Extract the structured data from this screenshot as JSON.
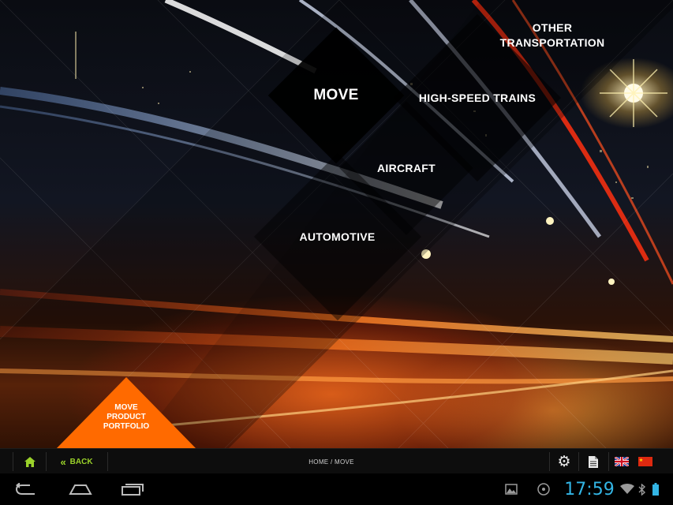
{
  "hero": {
    "tiles": {
      "move": "MOVE",
      "high_speed_trains": "HIGH-SPEED TRAINS",
      "other_line1": "OTHER",
      "other_line2": "TRANSPORTATION",
      "aircraft": "AIRCRAFT",
      "automotive": "AUTOMOTIVE"
    },
    "portfolio": {
      "line1": "MOVE",
      "line2": "PRODUCT",
      "line3": "PORTFOLIO"
    },
    "colors": {
      "accent_orange": "#ff6a00"
    }
  },
  "toolbar": {
    "back_label": "BACK",
    "breadcrumb": "HOME / MOVE",
    "colors": {
      "accent_green": "#9bd22a"
    }
  },
  "status": {
    "time": "17:59",
    "colors": {
      "clock": "#33b5e5"
    }
  },
  "icons": {
    "toolbar": [
      "home-icon",
      "back-chevron-icon",
      "gear-icon",
      "document-icon",
      "uk-flag-icon",
      "china-flag-icon"
    ],
    "nav": [
      "nav-back-icon",
      "nav-home-icon",
      "nav-recent-icon"
    ],
    "status": [
      "gallery-icon",
      "disc-icon",
      "wifi-icon",
      "bluetooth-icon",
      "battery-icon"
    ]
  }
}
